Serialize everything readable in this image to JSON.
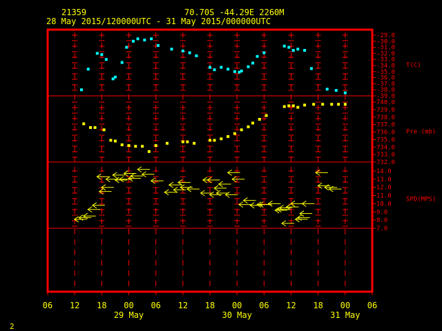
{
  "header": {
    "station_id": "21359",
    "location": "70.70S   -44.29E   2260M",
    "time_range": "28 May 2015/120000UTC - 31 May 2015/000000UTC"
  },
  "footer": {
    "page_number": "2"
  },
  "colors": {
    "background": "#000000",
    "frame": "#ff0000",
    "grid": "#ff0000",
    "text": "#ffff00",
    "temperature": "#00ffff",
    "pressure": "#ffff00",
    "wind": "#ffff00"
  },
  "chart_data": {
    "type": "scatter",
    "x_unit": "hours since 28 May 2015 06:00 UTC",
    "x_range": [
      0,
      72
    ],
    "x_ticks": [
      {
        "x": 0,
        "label": "06"
      },
      {
        "x": 6,
        "label": "12"
      },
      {
        "x": 12,
        "label": "18"
      },
      {
        "x": 18,
        "label": "00"
      },
      {
        "x": 24,
        "label": "06"
      },
      {
        "x": 30,
        "label": "12"
      },
      {
        "x": 36,
        "label": "18"
      },
      {
        "x": 42,
        "label": "00"
      },
      {
        "x": 48,
        "label": "06"
      },
      {
        "x": 54,
        "label": "12"
      },
      {
        "x": 60,
        "label": "18"
      },
      {
        "x": 66,
        "label": "00"
      },
      {
        "x": 72,
        "label": "06"
      }
    ],
    "date_labels": [
      {
        "x": 18,
        "label": "29 May"
      },
      {
        "x": 42,
        "label": "30 May"
      },
      {
        "x": 66,
        "label": "31 May"
      }
    ],
    "panels": [
      {
        "name": "T(C)",
        "ylim": [
          -39,
          -29
        ],
        "tick_labels": [
          "-29.0",
          "-30.0",
          "-31.0",
          "-32.0",
          "-33.0",
          "-34.0",
          "-35.0",
          "-36.0",
          "-37.0",
          "-38.0",
          "-39.0"
        ],
        "series": {
          "name": "T(C)",
          "points": [
            [
              7.5,
              -38.0
            ],
            [
              9,
              -34.6
            ],
            [
              11,
              -32.0
            ],
            [
              12,
              -32.2
            ],
            [
              13,
              -33.0
            ],
            [
              14.5,
              -36.2
            ],
            [
              15,
              -35.9
            ],
            [
              16.5,
              -33.5
            ],
            [
              17.5,
              -31.0
            ],
            [
              19,
              -30.0
            ],
            [
              20,
              -29.6
            ],
            [
              21.5,
              -29.8
            ],
            [
              23,
              -29.6
            ],
            [
              24.5,
              -30.7
            ],
            [
              27.5,
              -31.3
            ],
            [
              30,
              -31.6
            ],
            [
              31.5,
              -31.9
            ],
            [
              33,
              -32.4
            ],
            [
              36,
              -34.3
            ],
            [
              37,
              -34.7
            ],
            [
              38.5,
              -34.3
            ],
            [
              40,
              -34.6
            ],
            [
              41.5,
              -35.0
            ],
            [
              42.5,
              -35.1
            ],
            [
              43,
              -34.9
            ],
            [
              44.5,
              -34.2
            ],
            [
              45.5,
              -33.6
            ],
            [
              46.5,
              -32.5
            ],
            [
              48,
              -31.9
            ],
            [
              52.5,
              -30.8
            ],
            [
              53.5,
              -31.0
            ],
            [
              54.5,
              -31.5
            ],
            [
              55.5,
              -31.3
            ],
            [
              57,
              -31.5
            ],
            [
              58.5,
              -34.5
            ],
            [
              62,
              -37.9
            ],
            [
              64,
              -38.1
            ],
            [
              66,
              -38.5
            ]
          ]
        }
      },
      {
        "name": "Pre (mb)",
        "ylim": [
          732,
          740
        ],
        "tick_labels": [
          "740.0",
          "739.0",
          "738.0",
          "737.0",
          "736.0",
          "735.0",
          "734.0",
          "733.0",
          "732.0"
        ],
        "series": {
          "name": "Pre (mb)",
          "points": [
            [
              8,
              737.1
            ],
            [
              9.5,
              736.6
            ],
            [
              10.5,
              736.6
            ],
            [
              12.5,
              736.3
            ],
            [
              14,
              734.9
            ],
            [
              15,
              734.8
            ],
            [
              16.5,
              734.3
            ],
            [
              18,
              734.2
            ],
            [
              19.5,
              734.1
            ],
            [
              21,
              734.1
            ],
            [
              22.5,
              733.4
            ],
            [
              24,
              734.2
            ],
            [
              26.5,
              734.5
            ],
            [
              30,
              734.7
            ],
            [
              31,
              734.7
            ],
            [
              32.5,
              734.5
            ],
            [
              36,
              734.9
            ],
            [
              37,
              734.9
            ],
            [
              38.5,
              735.1
            ],
            [
              40,
              735.4
            ],
            [
              41.5,
              735.8
            ],
            [
              43,
              736.3
            ],
            [
              44.5,
              736.7
            ],
            [
              45.5,
              737.2
            ],
            [
              47,
              737.7
            ],
            [
              48.5,
              738.2
            ],
            [
              52.5,
              739.4
            ],
            [
              53.5,
              739.5
            ],
            [
              54.5,
              739.5
            ],
            [
              55.5,
              739.3
            ],
            [
              57,
              739.6
            ],
            [
              59,
              739.7
            ],
            [
              61,
              739.7
            ],
            [
              63,
              739.7
            ],
            [
              64.5,
              739.7
            ],
            [
              66,
              739.7
            ]
          ]
        }
      },
      {
        "name": "SPD(MPS)",
        "ylim": [
          7,
          14
        ],
        "tick_labels": [
          "14.0",
          "13.0",
          "12.0",
          "11.0",
          "10.0",
          "9.0",
          "8.0",
          "7.0"
        ],
        "series": {
          "name": "SPD(MPS)",
          "points": [
            [
              7,
              8.1
            ],
            [
              8,
              8.3
            ],
            [
              9,
              8.5
            ],
            [
              10,
              9.3
            ],
            [
              11,
              9.8
            ],
            [
              12,
              13.3
            ],
            [
              12.5,
              11.5
            ],
            [
              13,
              12.0
            ],
            [
              14,
              13.0
            ],
            [
              15.5,
              13.5
            ],
            [
              16,
              12.9
            ],
            [
              17,
              13.0
            ],
            [
              18,
              13.7
            ],
            [
              19,
              13.1
            ],
            [
              19.5,
              13.4
            ],
            [
              21,
              14.2
            ],
            [
              22,
              13.6
            ],
            [
              24,
              12.8
            ],
            [
              27,
              11.4
            ],
            [
              28,
              12.3
            ],
            [
              29,
              11.7
            ],
            [
              30,
              12.6
            ],
            [
              30.5,
              12.0
            ],
            [
              32,
              11.8
            ],
            [
              35,
              11.3
            ],
            [
              35.5,
              12.9
            ],
            [
              36.5,
              12.9
            ],
            [
              37,
              11.1
            ],
            [
              38,
              11.9
            ],
            [
              38.5,
              11.3
            ],
            [
              39,
              12.4
            ],
            [
              40.5,
              11.1
            ],
            [
              41,
              13.8
            ],
            [
              42,
              13.0
            ],
            [
              43.5,
              9.9
            ],
            [
              44.5,
              10.4
            ],
            [
              46,
              9.8
            ],
            [
              47.5,
              9.9
            ],
            [
              48,
              9.9
            ],
            [
              50,
              10.0
            ],
            [
              51.5,
              9.2
            ],
            [
              52,
              9.3
            ],
            [
              52.5,
              9.5
            ],
            [
              53,
              7.6
            ],
            [
              54,
              9.6
            ],
            [
              55,
              10.0
            ],
            [
              56,
              8.1
            ],
            [
              56.5,
              8.3
            ],
            [
              57,
              8.8
            ],
            [
              57.5,
              10.0
            ],
            [
              60.5,
              13.8
            ],
            [
              61,
              12.2
            ],
            [
              62.5,
              12.0
            ],
            [
              63.5,
              11.8
            ]
          ]
        }
      }
    ],
    "title": "",
    "xlabel": "",
    "ylabel": "",
    "grid": true,
    "legend": "none"
  }
}
